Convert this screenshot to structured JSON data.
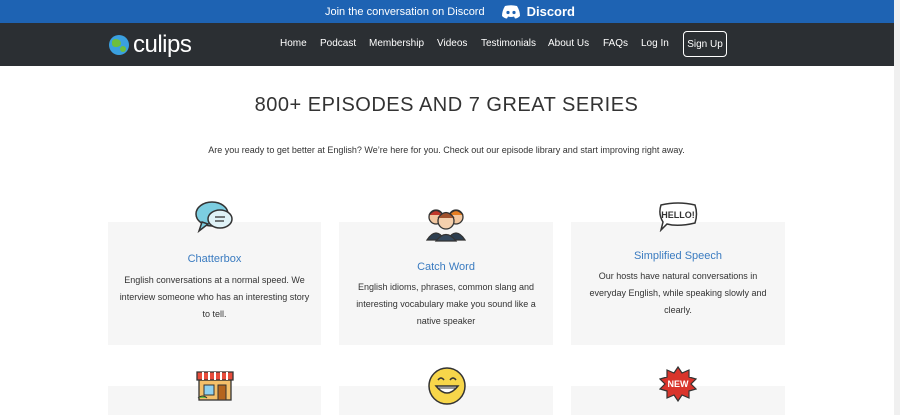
{
  "announcement": {
    "text": "Join the conversation on Discord",
    "discord_label": "Discord"
  },
  "brand": {
    "logo_text": "culips"
  },
  "nav": {
    "items": [
      "Home",
      "Podcast",
      "Membership",
      "Videos",
      "Testimonials",
      "About Us",
      "FAQs",
      "Log In"
    ],
    "signup": "Sign Up"
  },
  "hero": {
    "title": "800+ EPISODES AND 7 GREAT SERIES",
    "subtitle": "Are you ready to get better at English? We’re here for you. Check out our episode library and start improving right away."
  },
  "series": [
    {
      "name": "Chatterbox",
      "description": "English conversations at a normal speed. We interview someone who has an interesting story to tell.",
      "icon": "speech-bubbles-icon"
    },
    {
      "name": "Catch Word",
      "description": "English idioms, phrases, common slang and interesting vocabulary make you sound like a native speaker",
      "icon": "people-icon"
    },
    {
      "name": "Simplified Speech",
      "description": "Our hosts have natural conversations in everyday English, while speaking slowly and clearly.",
      "icon": "hello-bubble-icon"
    }
  ],
  "lower_icons": {
    "shop_icon": "storefront-icon",
    "smile_icon": "grinning-face-icon",
    "new_label": "NEW"
  },
  "colors": {
    "announce_bg": "#1e63b3",
    "nav_bg": "#2b2f33",
    "accent": "#3a7bc0",
    "card_bg": "#f6f6f6"
  }
}
